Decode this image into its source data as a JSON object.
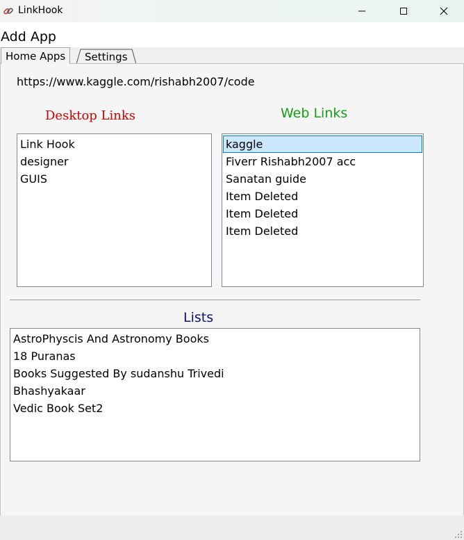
{
  "window": {
    "title": "LinkHook",
    "icon": "link-icon"
  },
  "menu": {
    "add_app": "Add App"
  },
  "tabs": [
    {
      "label": "Home Apps",
      "selected": true
    },
    {
      "label": "Settings",
      "selected": false
    }
  ],
  "home": {
    "url_text": "https://www.kaggle.com/rishabh2007/code",
    "desktop_heading": "Desktop Links",
    "web_heading": "Web Links",
    "lists_heading": "Lists",
    "desktop_links": [
      "Link Hook",
      "designer",
      "GUIS"
    ],
    "web_links": [
      "kaggle",
      "Fiverr Rishabh2007 acc",
      "Sanatan guide",
      "Item Deleted",
      "Item Deleted",
      "Item Deleted"
    ],
    "web_selected": "kaggle",
    "lists": [
      "AstroPhyscis And Astronomy Books",
      "18 Puranas",
      "Books Suggested By sudanshu Trivedi",
      "Bhashyakaar",
      "Vedic Book Set2"
    ]
  },
  "colors": {
    "desktop_heading": "#c80000",
    "web_heading": "#14a014",
    "lists_heading": "#10106e",
    "selection": "#cce8ff",
    "selection_border": "#0078d7"
  }
}
